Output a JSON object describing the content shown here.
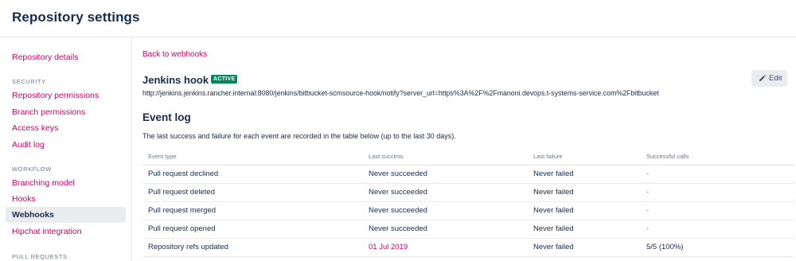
{
  "header": {
    "title": "Repository settings"
  },
  "sidebar": {
    "repository_details": "Repository details",
    "security_heading": "SECURITY",
    "security_items": [
      "Repository permissions",
      "Branch permissions",
      "Access keys",
      "Audit log"
    ],
    "workflow_heading": "WORKFLOW",
    "workflow_items": [
      "Branching model",
      "Hooks"
    ],
    "selected_item": "Webhooks",
    "hipchat": "Hipchat integration",
    "pull_requests_heading": "PULL REQUESTS"
  },
  "main": {
    "back_link": "Back to webhooks",
    "hook_name": "Jenkins hook",
    "status_badge": "ACTIVE",
    "hook_url": "http://jenkins.jenkins.rancher.internal:8080/jenkins/bitbucket-scmsource-hook/notify?server_url=https%3A%2F%2Fmanoni.devops.t-systems-service.com%2Fbitbucket",
    "edit_label": "Edit",
    "event_log_title": "Event log",
    "event_log_desc": "The last success and failure for each event are recorded in the table below (up to the last 30 days).",
    "table": {
      "headers": [
        "Event type",
        "Last success",
        "Last failure",
        "Successful calls"
      ],
      "rows": [
        [
          "Pull request declined",
          "Never succeeded",
          "Never failed",
          "-"
        ],
        [
          "Pull request deleted",
          "Never succeeded",
          "Never failed",
          "-"
        ],
        [
          "Pull request merged",
          "Never succeeded",
          "Never failed",
          "-"
        ],
        [
          "Pull request opened",
          "Never succeeded",
          "Never failed",
          "-"
        ],
        [
          "Repository refs updated",
          "01 Jul 2019",
          "Never failed",
          "5/5 (100%)"
        ]
      ]
    }
  },
  "colors": {
    "accent": "#d1006e",
    "active_badge": "#00875a",
    "text": "#172b4d",
    "muted": "#6b778c"
  },
  "icons": {
    "edit": "pencil-icon"
  }
}
